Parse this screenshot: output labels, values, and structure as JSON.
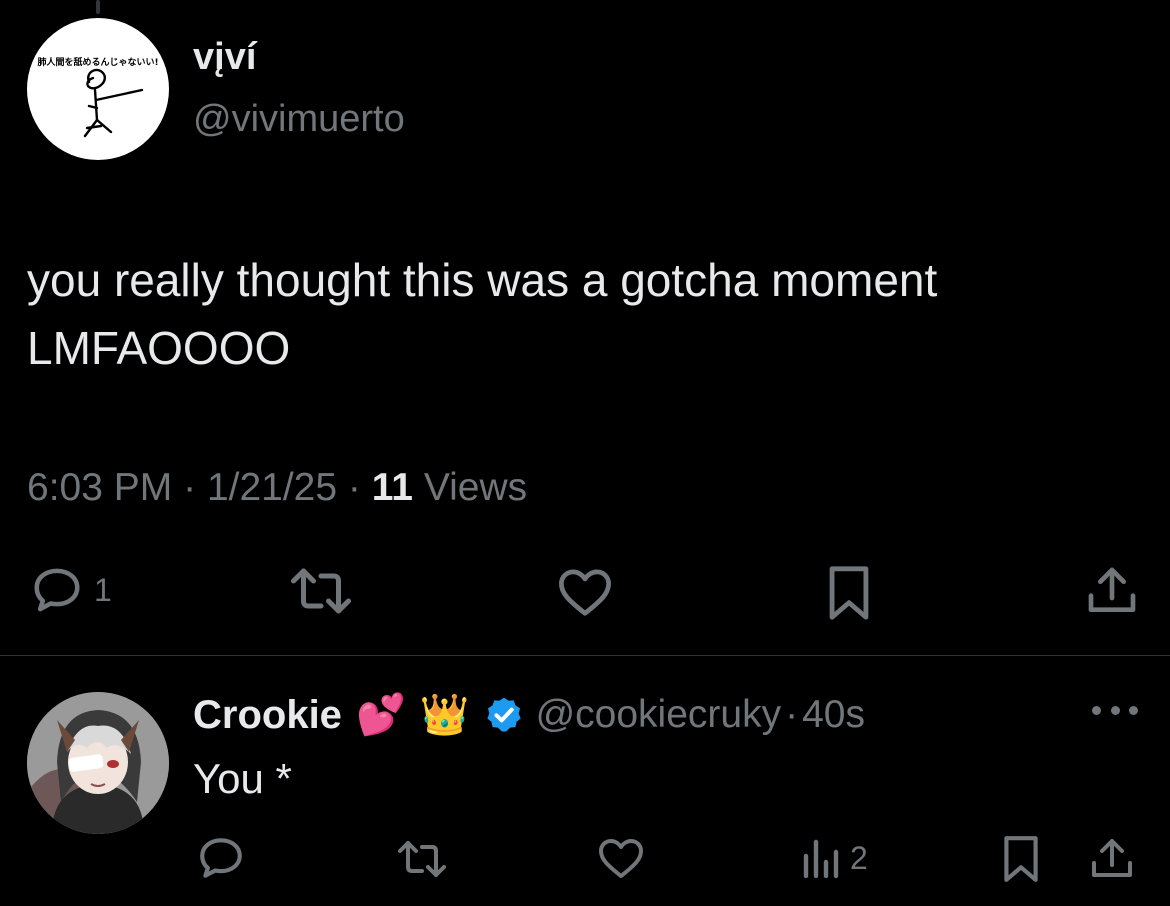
{
  "main_tweet": {
    "display_name": "vįví",
    "handle": "@vivimuerto",
    "avatar_text": "肺人間を舐めるんじゃないい!",
    "text_lines": [
      "you really thought this was a gotcha moment",
      "LMFAOOOO"
    ],
    "time": "6:03 PM",
    "date": "1/21/25",
    "separator": "·",
    "views_count": "11",
    "views_label": "Views",
    "actions": {
      "reply_count": "1"
    }
  },
  "reply": {
    "display_name": "Crookie",
    "emojis": [
      "💕",
      "👑"
    ],
    "handle": "@cookiecruky",
    "separator": "·",
    "time": "40s",
    "text": "You *",
    "actions": {
      "views_count": "2"
    }
  },
  "colors": {
    "background": "#000000",
    "text_primary": "#e7e9ea",
    "text_secondary": "#71767b",
    "verified_blue": "#1d9bf0",
    "divider": "#2f3336"
  }
}
